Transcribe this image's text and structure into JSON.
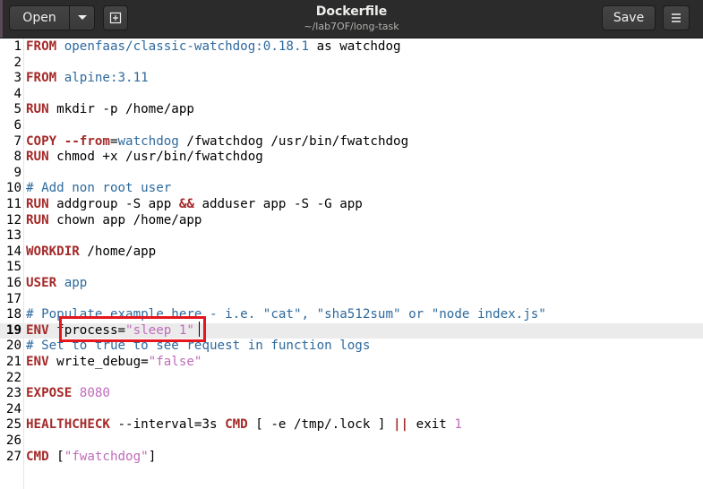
{
  "header": {
    "open_label": "Open",
    "title": "Dockerfile",
    "subtitle": "~/lab7OF/long-task",
    "save_label": "Save"
  },
  "editor": {
    "current_line": 19,
    "lines": [
      {
        "n": "1",
        "tokens": [
          [
            "FROM",
            "kw"
          ],
          [
            " ",
            ""
          ],
          [
            "openfaas/classic-watchdog:0.18.1",
            "blue"
          ],
          [
            " as watchdog",
            ""
          ]
        ]
      },
      {
        "n": "2",
        "tokens": []
      },
      {
        "n": "3",
        "tokens": [
          [
            "FROM",
            "kw"
          ],
          [
            " ",
            ""
          ],
          [
            "alpine:3.11",
            "blue"
          ]
        ]
      },
      {
        "n": "4",
        "tokens": []
      },
      {
        "n": "5",
        "tokens": [
          [
            "RUN",
            "kw"
          ],
          [
            " mkdir -p /home/app",
            ""
          ]
        ]
      },
      {
        "n": "6",
        "tokens": []
      },
      {
        "n": "7",
        "tokens": [
          [
            "COPY",
            "kw"
          ],
          [
            " ",
            ""
          ],
          [
            "--from",
            "kw"
          ],
          [
            "=",
            ""
          ],
          [
            "watchdog",
            "blue"
          ],
          [
            " /fwatchdog /usr/bin/fwatchdog",
            ""
          ]
        ]
      },
      {
        "n": "8",
        "tokens": [
          [
            "RUN",
            "kw"
          ],
          [
            " chmod +x /usr/bin/fwatchdog",
            ""
          ]
        ]
      },
      {
        "n": "9",
        "tokens": []
      },
      {
        "n": "10",
        "tokens": [
          [
            "# Add non root user",
            "cmt"
          ]
        ]
      },
      {
        "n": "11",
        "tokens": [
          [
            "RUN",
            "kw"
          ],
          [
            " addgroup -S app ",
            ""
          ],
          [
            "&&",
            "op"
          ],
          [
            " adduser app -S -G app",
            ""
          ]
        ]
      },
      {
        "n": "12",
        "tokens": [
          [
            "RUN",
            "kw"
          ],
          [
            " chown app /home/app",
            ""
          ]
        ]
      },
      {
        "n": "13",
        "tokens": []
      },
      {
        "n": "14",
        "tokens": [
          [
            "WORKDIR",
            "kw"
          ],
          [
            " /home/app",
            ""
          ]
        ]
      },
      {
        "n": "15",
        "tokens": []
      },
      {
        "n": "16",
        "tokens": [
          [
            "USER",
            "kw"
          ],
          [
            " ",
            ""
          ],
          [
            "app",
            "blue"
          ]
        ]
      },
      {
        "n": "17",
        "tokens": []
      },
      {
        "n": "18",
        "tokens": [
          [
            "# Populate example here - i.e. \"cat\", \"sha512sum\" or \"node index.js\"",
            "cmt"
          ]
        ]
      },
      {
        "n": "19",
        "tokens": [
          [
            "ENV",
            "kw"
          ],
          [
            " fprocess=",
            ""
          ],
          [
            "\"sleep 1\"",
            "str"
          ]
        ]
      },
      {
        "n": "20",
        "tokens": [
          [
            "# Set to true to see request in function logs",
            "cmt"
          ]
        ]
      },
      {
        "n": "21",
        "tokens": [
          [
            "ENV",
            "kw"
          ],
          [
            " write_debug=",
            ""
          ],
          [
            "\"false\"",
            "str"
          ]
        ]
      },
      {
        "n": "22",
        "tokens": []
      },
      {
        "n": "23",
        "tokens": [
          [
            "EXPOSE",
            "kw"
          ],
          [
            " ",
            ""
          ],
          [
            "8080",
            "num"
          ]
        ]
      },
      {
        "n": "24",
        "tokens": []
      },
      {
        "n": "25",
        "tokens": [
          [
            "HEALTHCHECK",
            "kw"
          ],
          [
            " --interval=3s ",
            ""
          ],
          [
            "CMD",
            "kw"
          ],
          [
            " [ -e /tmp/.lock ] ",
            ""
          ],
          [
            "||",
            "op"
          ],
          [
            " exit ",
            ""
          ],
          [
            "1",
            "num"
          ]
        ]
      },
      {
        "n": "26",
        "tokens": []
      },
      {
        "n": "27",
        "tokens": [
          [
            "CMD",
            "kw"
          ],
          [
            " [",
            ""
          ],
          [
            "\"fwatchdog\"",
            "str"
          ],
          [
            "]",
            ""
          ]
        ]
      }
    ]
  }
}
